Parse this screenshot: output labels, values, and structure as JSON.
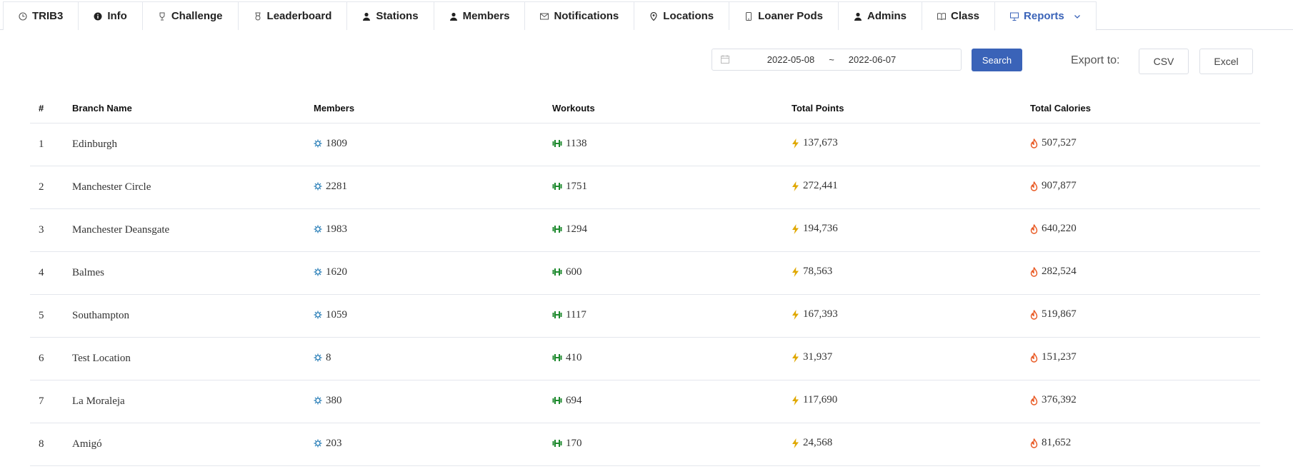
{
  "tabs": [
    {
      "label": "TRIB3",
      "icon": "clock-icon",
      "name": "tab-trib3"
    },
    {
      "label": "Info",
      "icon": "info-icon",
      "name": "tab-info"
    },
    {
      "label": "Challenge",
      "icon": "trophy-icon",
      "name": "tab-challenge"
    },
    {
      "label": "Leaderboard",
      "icon": "medal-icon",
      "name": "tab-leaderboard"
    },
    {
      "label": "Stations",
      "icon": "user-icon",
      "name": "tab-stations"
    },
    {
      "label": "Members",
      "icon": "user-icon",
      "name": "tab-members"
    },
    {
      "label": "Notifications",
      "icon": "mail-icon",
      "name": "tab-notifications"
    },
    {
      "label": "Locations",
      "icon": "location-pin-icon",
      "name": "tab-locations"
    },
    {
      "label": "Loaner Pods",
      "icon": "phone-icon",
      "name": "tab-loaner-pods"
    },
    {
      "label": "Admins",
      "icon": "user-icon",
      "name": "tab-admins"
    },
    {
      "label": "Class",
      "icon": "book-icon",
      "name": "tab-class"
    },
    {
      "label": "Reports",
      "icon": "report-icon",
      "name": "tab-reports",
      "active": true
    }
  ],
  "date_range": {
    "start": "2022-05-08",
    "separator": "~",
    "end": "2022-06-07"
  },
  "toolbar": {
    "search_label": "Search",
    "export_label": "Export to:",
    "csv_label": "CSV",
    "excel_label": "Excel"
  },
  "table": {
    "columns": [
      "#",
      "Branch Name",
      "Members",
      "Workouts",
      "Total Points",
      "Total Calories"
    ],
    "rows": [
      {
        "index": "1",
        "branch": "Edinburgh",
        "members": "1809",
        "workouts": "1138",
        "points": "137,673",
        "calories": "507,527"
      },
      {
        "index": "2",
        "branch": "Manchester Circle",
        "members": "2281",
        "workouts": "1751",
        "points": "272,441",
        "calories": "907,877"
      },
      {
        "index": "3",
        "branch": "Manchester Deansgate",
        "members": "1983",
        "workouts": "1294",
        "points": "194,736",
        "calories": "640,220"
      },
      {
        "index": "4",
        "branch": "Balmes",
        "members": "1620",
        "workouts": "600",
        "points": "78,563",
        "calories": "282,524"
      },
      {
        "index": "5",
        "branch": "Southampton",
        "members": "1059",
        "workouts": "1117",
        "points": "167,393",
        "calories": "519,867"
      },
      {
        "index": "6",
        "branch": "Test Location",
        "members": "8",
        "workouts": "410",
        "points": "31,937",
        "calories": "151,237"
      },
      {
        "index": "7",
        "branch": "La Moraleja",
        "members": "380",
        "workouts": "694",
        "points": "117,690",
        "calories": "376,392"
      },
      {
        "index": "8",
        "branch": "Amigó",
        "members": "203",
        "workouts": "170",
        "points": "24,568",
        "calories": "81,652"
      }
    ]
  },
  "colors": {
    "accent": "#3a63b8",
    "members_icon": "#2a7fb8",
    "workouts_icon": "#1e8a2e",
    "points_icon": "#e0a800",
    "calories_icon": "#e8551e"
  }
}
